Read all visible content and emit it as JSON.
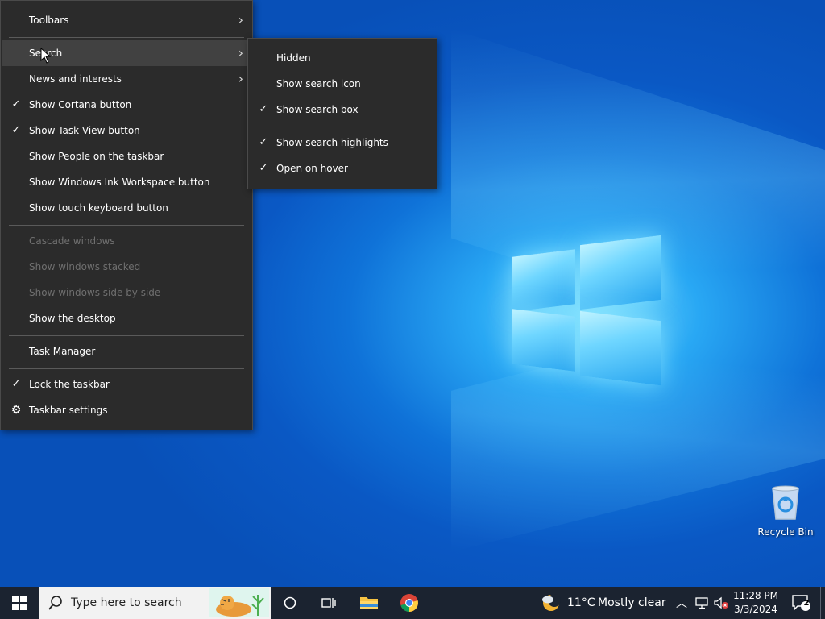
{
  "main_menu": {
    "items": [
      {
        "label": "Toolbars",
        "checked": false,
        "submenu": true,
        "disabled": false
      },
      {
        "label": "Search",
        "checked": false,
        "submenu": true,
        "disabled": false,
        "hover": true
      },
      {
        "label": "News and interests",
        "checked": false,
        "submenu": true,
        "disabled": false
      },
      {
        "label": "Show Cortana button",
        "checked": true,
        "submenu": false,
        "disabled": false
      },
      {
        "label": "Show Task View button",
        "checked": true,
        "submenu": false,
        "disabled": false
      },
      {
        "label": "Show People on the taskbar",
        "checked": false,
        "submenu": false,
        "disabled": false
      },
      {
        "label": "Show Windows Ink Workspace button",
        "checked": false,
        "submenu": false,
        "disabled": false
      },
      {
        "label": "Show touch keyboard button",
        "checked": false,
        "submenu": false,
        "disabled": false
      },
      {
        "label": "Cascade windows",
        "checked": false,
        "submenu": false,
        "disabled": true
      },
      {
        "label": "Show windows stacked",
        "checked": false,
        "submenu": false,
        "disabled": true
      },
      {
        "label": "Show windows side by side",
        "checked": false,
        "submenu": false,
        "disabled": true
      },
      {
        "label": "Show the desktop",
        "checked": false,
        "submenu": false,
        "disabled": false
      },
      {
        "label": "Task Manager",
        "checked": false,
        "submenu": false,
        "disabled": false
      },
      {
        "label": "Lock the taskbar",
        "checked": true,
        "submenu": false,
        "disabled": false
      },
      {
        "label": "Taskbar settings",
        "checked": false,
        "submenu": false,
        "disabled": false,
        "icon": "gear-icon"
      }
    ]
  },
  "search_submenu": {
    "items": [
      {
        "label": "Hidden",
        "checked": false
      },
      {
        "label": "Show search icon",
        "checked": false
      },
      {
        "label": "Show search box",
        "checked": true
      },
      {
        "label": "Show search highlights",
        "checked": true
      },
      {
        "label": "Open on hover",
        "checked": true
      }
    ]
  },
  "desktop": {
    "recycle_bin_label": "Recycle Bin"
  },
  "taskbar": {
    "search_placeholder": "Type here to search",
    "weather_temp": "11°C",
    "weather_desc": "Mostly clear",
    "time": "11:28 PM",
    "date": "3/3/2024",
    "notification_count": "2",
    "accent_color": "#0a58c4",
    "taskbar_color": "#1b2330"
  }
}
